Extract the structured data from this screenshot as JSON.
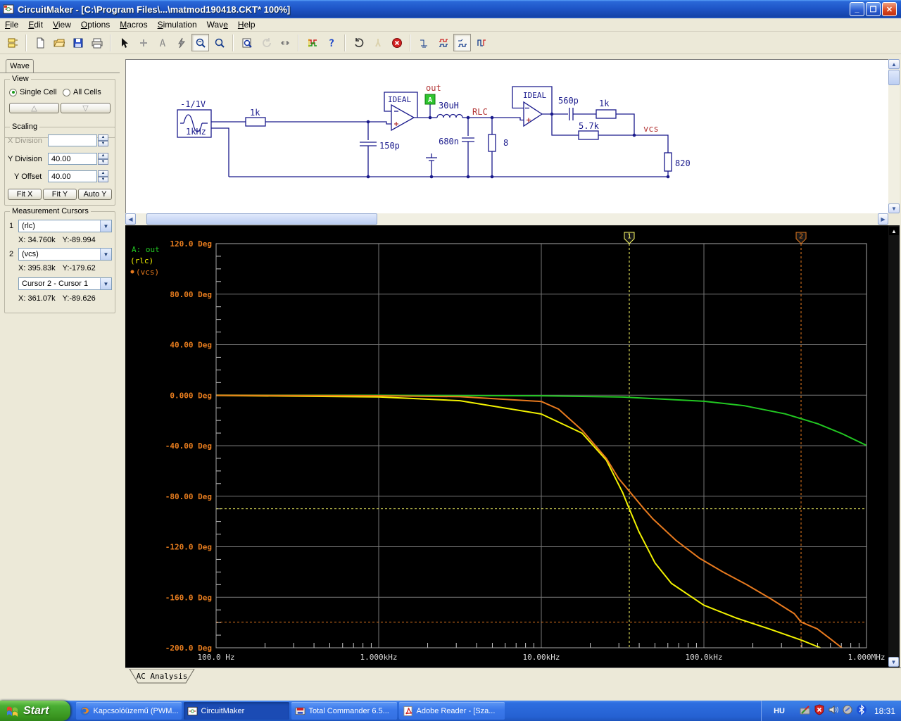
{
  "window": {
    "title": "CircuitMaker - [C:\\Program Files\\...\\matmod190418.CKT* 100%]",
    "buttons": {
      "minimize": "_",
      "restore": "❐",
      "close": "✕"
    }
  },
  "menu": {
    "items": [
      {
        "label": "File",
        "u": 0
      },
      {
        "label": "Edit",
        "u": 0
      },
      {
        "label": "View",
        "u": 0
      },
      {
        "label": "Options",
        "u": 0
      },
      {
        "label": "Macros",
        "u": 0
      },
      {
        "label": "Simulation",
        "u": 0
      },
      {
        "label": "Wave",
        "u": 3
      },
      {
        "label": "Help",
        "u": 0
      }
    ]
  },
  "toolbar": {
    "groups": [
      [
        {
          "name": "browse-parts-button",
          "glyph": "parts"
        }
      ],
      [
        {
          "name": "new-file-button",
          "glyph": "new"
        },
        {
          "name": "open-file-button",
          "glyph": "open"
        },
        {
          "name": "save-button",
          "glyph": "save"
        },
        {
          "name": "print-button",
          "glyph": "print"
        }
      ],
      [
        {
          "name": "select-arrow-button",
          "glyph": "arrow"
        },
        {
          "name": "wire-tool-button",
          "glyph": "plus"
        },
        {
          "name": "text-tool-button",
          "glyph": "text"
        },
        {
          "name": "delete-tool-button",
          "glyph": "bolt"
        },
        {
          "name": "probe-tool-button",
          "glyph": "probe",
          "pressed": true
        },
        {
          "name": "zoom-tool-button",
          "glyph": "zoom"
        }
      ],
      [
        {
          "name": "zoom-window-button",
          "glyph": "zoomwin"
        },
        {
          "name": "rotate-button",
          "glyph": "rotate",
          "disabled": true
        },
        {
          "name": "split-view-button",
          "glyph": "split"
        }
      ],
      [
        {
          "name": "trace-options-button",
          "glyph": "traces"
        },
        {
          "name": "help-button",
          "glyph": "help"
        }
      ],
      [
        {
          "name": "reset-simulation-button",
          "glyph": "reset"
        },
        {
          "name": "probe-setup-button",
          "glyph": "wrench",
          "disabled": true
        },
        {
          "name": "stop-simulation-button",
          "glyph": "stop"
        }
      ],
      [
        {
          "name": "scope-step-button",
          "glyph": "scope1"
        },
        {
          "name": "scope-multi-button",
          "glyph": "scope2"
        },
        {
          "name": "scope-probe-button",
          "glyph": "scope3",
          "pressed": true
        },
        {
          "name": "scope-split-button",
          "glyph": "scope4"
        }
      ]
    ]
  },
  "sidebar": {
    "tab": "Wave",
    "view": {
      "label": "View",
      "single_cell": "Single Cell",
      "all_cells": "All Cells",
      "selected": "Single Cell",
      "up_glyph": "△",
      "down_glyph": "▽"
    },
    "scaling": {
      "label": "Scaling",
      "x_division_label": "X Division",
      "x_division_value": "",
      "y_division_label": "Y Division",
      "y_division_value": "40.00",
      "y_offset_label": "Y Offset",
      "y_offset_value": "40.00",
      "fit_x": "Fit X",
      "fit_y": "Fit Y",
      "auto_y": "Auto Y"
    },
    "cursors": {
      "label": "Measurement Cursors",
      "cursor1": {
        "num": "1",
        "signal": "(rlc)",
        "x": "X: 34.760k",
        "y": "Y:-89.994"
      },
      "cursor2": {
        "num": "2",
        "signal": "(vcs)",
        "x": "X: 395.83k",
        "y": "Y:-179.62"
      },
      "diff": {
        "signal": "Cursor 2 - Cursor 1",
        "x": "X: 361.07k",
        "y": "Y:-89.626"
      }
    }
  },
  "schematic": {
    "source_amplitude": "-1/1V",
    "source_freq": "1kHz",
    "r1": "1k",
    "c1": "150p",
    "opamp1": "IDEAL",
    "node_out": "out",
    "probe": "A",
    "l1": "30uH",
    "node_rlc": "RLC",
    "c2": "680n",
    "r2": "8",
    "opamp2": "IDEAL",
    "c3": "560p",
    "r3": "1k",
    "r4": "5.7k",
    "node_vcs": "vcs",
    "r5": "820"
  },
  "chart_data": {
    "type": "line",
    "title": "AC Analysis",
    "x_scale": "log",
    "x_range_hz": [
      100,
      1000000
    ],
    "y_range_deg": [
      -200,
      120
    ],
    "grid": true,
    "x_tick_labels": [
      "100.0 Hz",
      "1.000kHz",
      "10.00kHz",
      "100.0kHz",
      "1.000MHz"
    ],
    "y_tick_labels": [
      "120.0 Deg",
      "80.00 Deg",
      "40.00 Deg",
      "0.000 Deg",
      "-40.00 Deg",
      "-80.00 Deg",
      "-120.0 Deg",
      "-160.0 Deg",
      "-200.0 Deg"
    ],
    "legend": [
      {
        "label": "A: out",
        "color": "#22c822"
      },
      {
        "label": "(rlc)",
        "color": "#f2f200"
      },
      {
        "label": "(vcs)",
        "color": "#e87a1e",
        "bullet": true
      }
    ],
    "series": [
      {
        "name": "out",
        "color": "#22c822",
        "points": [
          [
            100,
            0
          ],
          [
            1000,
            -0.1
          ],
          [
            10000,
            -0.5
          ],
          [
            31623,
            -1.5
          ],
          [
            100000,
            -4.8
          ],
          [
            177828,
            -8.4
          ],
          [
            316228,
            -14.8
          ],
          [
            501187,
            -22.6
          ],
          [
            707946,
            -30.5
          ],
          [
            1000000,
            -39.8
          ]
        ]
      },
      {
        "name": "rlc",
        "color": "#f2f200",
        "points": [
          [
            100,
            -0.2
          ],
          [
            1000,
            -1.4
          ],
          [
            3162,
            -4.4
          ],
          [
            10000,
            -14.9
          ],
          [
            17783,
            -30
          ],
          [
            25119,
            -51.5
          ],
          [
            31623,
            -77
          ],
          [
            34760,
            -90
          ],
          [
            39811,
            -108
          ],
          [
            50119,
            -133
          ],
          [
            63096,
            -149
          ],
          [
            100000,
            -166.3
          ],
          [
            158489,
            -176.5
          ],
          [
            251189,
            -185
          ],
          [
            398107,
            -194
          ],
          [
            520000,
            -200
          ]
        ]
      },
      {
        "name": "vcs",
        "color": "#e87a1e",
        "points": [
          [
            100,
            -0.1
          ],
          [
            1000,
            -0.4
          ],
          [
            3162,
            -1.2
          ],
          [
            10000,
            -5
          ],
          [
            12760,
            -11
          ],
          [
            17900,
            -28
          ],
          [
            25100,
            -50
          ],
          [
            29900,
            -66
          ],
          [
            34760,
            -76
          ],
          [
            42800,
            -90
          ],
          [
            48600,
            -98
          ],
          [
            67400,
            -115
          ],
          [
            93600,
            -129
          ],
          [
            131000,
            -140
          ],
          [
            183000,
            -150
          ],
          [
            256000,
            -161
          ],
          [
            360000,
            -173
          ],
          [
            395830,
            -179.6
          ],
          [
            497000,
            -185
          ],
          [
            600000,
            -193
          ],
          [
            705000,
            -200
          ]
        ]
      }
    ],
    "cursors": [
      {
        "id": "1",
        "x_hz": 34760,
        "y_deg": -89.994,
        "color": "#ffff66"
      },
      {
        "id": "2",
        "x_hz": 395830,
        "y_deg": -179.62,
        "color": "#e87a1e"
      }
    ]
  },
  "bottom_tab": "AC Analysis",
  "taskbar": {
    "start": "Start",
    "tasks": [
      {
        "name": "task-firefox",
        "label": "Kapcsolóüzemű (PWM...",
        "icon": "firefox",
        "active": false
      },
      {
        "name": "task-circuitmaker",
        "label": "CircuitMaker",
        "icon": "circuitmaker",
        "active": true
      },
      {
        "name": "task-totalcommander",
        "label": "Total Commander 6.5...",
        "icon": "totalcmd",
        "active": false
      },
      {
        "name": "task-adobe",
        "label": "Adobe Reader - [Sza...",
        "icon": "adobe",
        "active": false
      }
    ],
    "language": "HU",
    "clock": "18:31",
    "tray_icons": [
      "tablet-icon",
      "security-shield-icon",
      "volume-icon",
      "device-icon",
      "bluetooth-icon"
    ]
  }
}
